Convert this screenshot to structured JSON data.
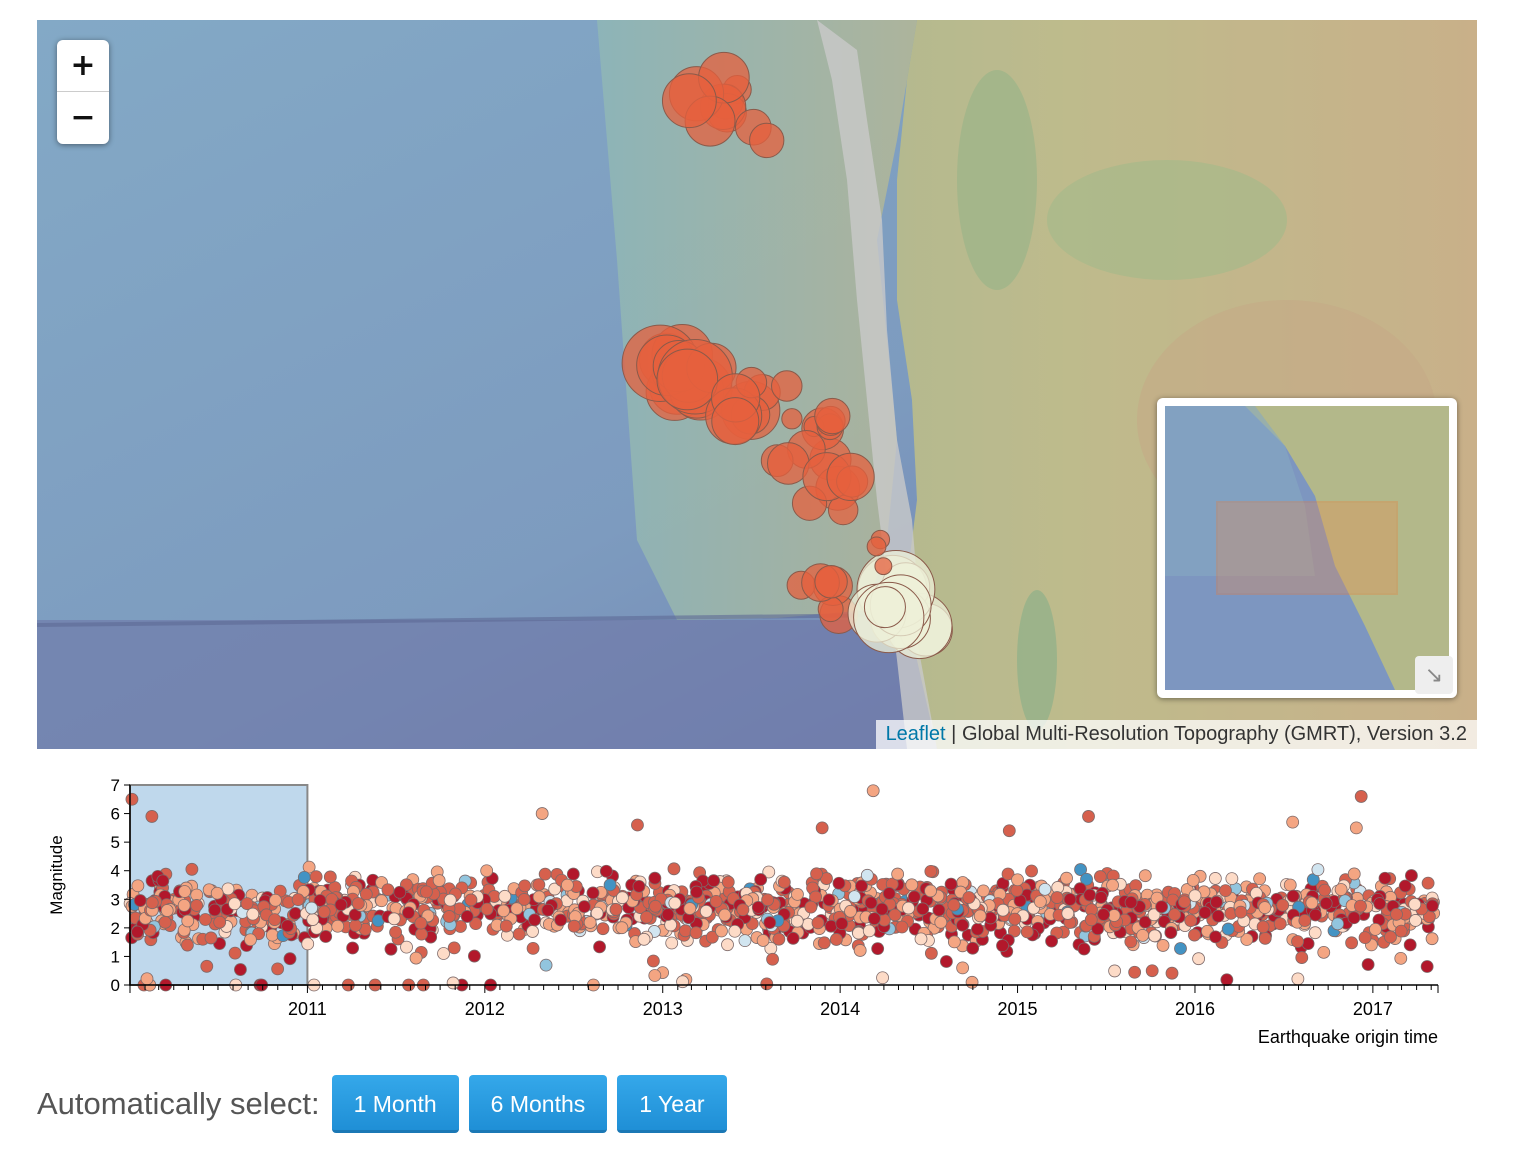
{
  "map": {
    "zoom_in_label": "+",
    "zoom_out_label": "−",
    "attribution_link": "Leaflet",
    "attribution_separator": " | ",
    "attribution_text": "Global Multi-Resolution Topography (GMRT), Version 3.2",
    "minimap_toggle_icon": "collapse-arrow-icon",
    "colors": {
      "quake_orange": "#e6603e",
      "quake_pale": "#f3e6b8",
      "ocean": "#6f8fb8",
      "land": "#b7b07d"
    }
  },
  "chart_data": {
    "type": "scatter",
    "title": "",
    "xlabel": "Earthquake origin time",
    "ylabel": "Magnitude",
    "xlim": [
      "2010-01-01",
      "2017-05-15"
    ],
    "ylim": [
      0,
      7
    ],
    "y_ticks": [
      0,
      1,
      2,
      3,
      4,
      5,
      6,
      7
    ],
    "x_ticks": [
      "2011",
      "2012",
      "2013",
      "2014",
      "2015",
      "2016",
      "2017"
    ],
    "brush_selection": [
      "2010-01-01",
      "2011-01-01"
    ],
    "grid": false,
    "colors": [
      "#b2182b",
      "#d6604d",
      "#f4a582",
      "#fddbc7",
      "#d1e5f0",
      "#92c5de",
      "#4393c3"
    ],
    "highlight_points": [
      {
        "x": "2014-03-10",
        "y": 6.8
      },
      {
        "x": "2016-12-08",
        "y": 6.6
      },
      {
        "x": "2010-01-05",
        "y": 6.5
      },
      {
        "x": "2012-04-28",
        "y": 6.0
      },
      {
        "x": "2010-02-15",
        "y": 5.9
      },
      {
        "x": "2015-05-27",
        "y": 5.9
      },
      {
        "x": "2016-07-20",
        "y": 5.7
      },
      {
        "x": "2012-11-10",
        "y": 5.6
      },
      {
        "x": "2013-11-25",
        "y": 5.5
      },
      {
        "x": "2016-11-28",
        "y": 5.5
      },
      {
        "x": "2014-12-15",
        "y": 5.4
      },
      {
        "x": "2015-10-05",
        "y": 0.5
      },
      {
        "x": "2014-09-10",
        "y": 0.6
      },
      {
        "x": "2013-08-15",
        "y": 0.9
      },
      {
        "x": "2011-10-30",
        "y": 1.3
      }
    ]
  },
  "auto_select": {
    "label": "Automatically select:",
    "buttons": [
      "1 Month",
      "6 Months",
      "1 Year"
    ]
  }
}
